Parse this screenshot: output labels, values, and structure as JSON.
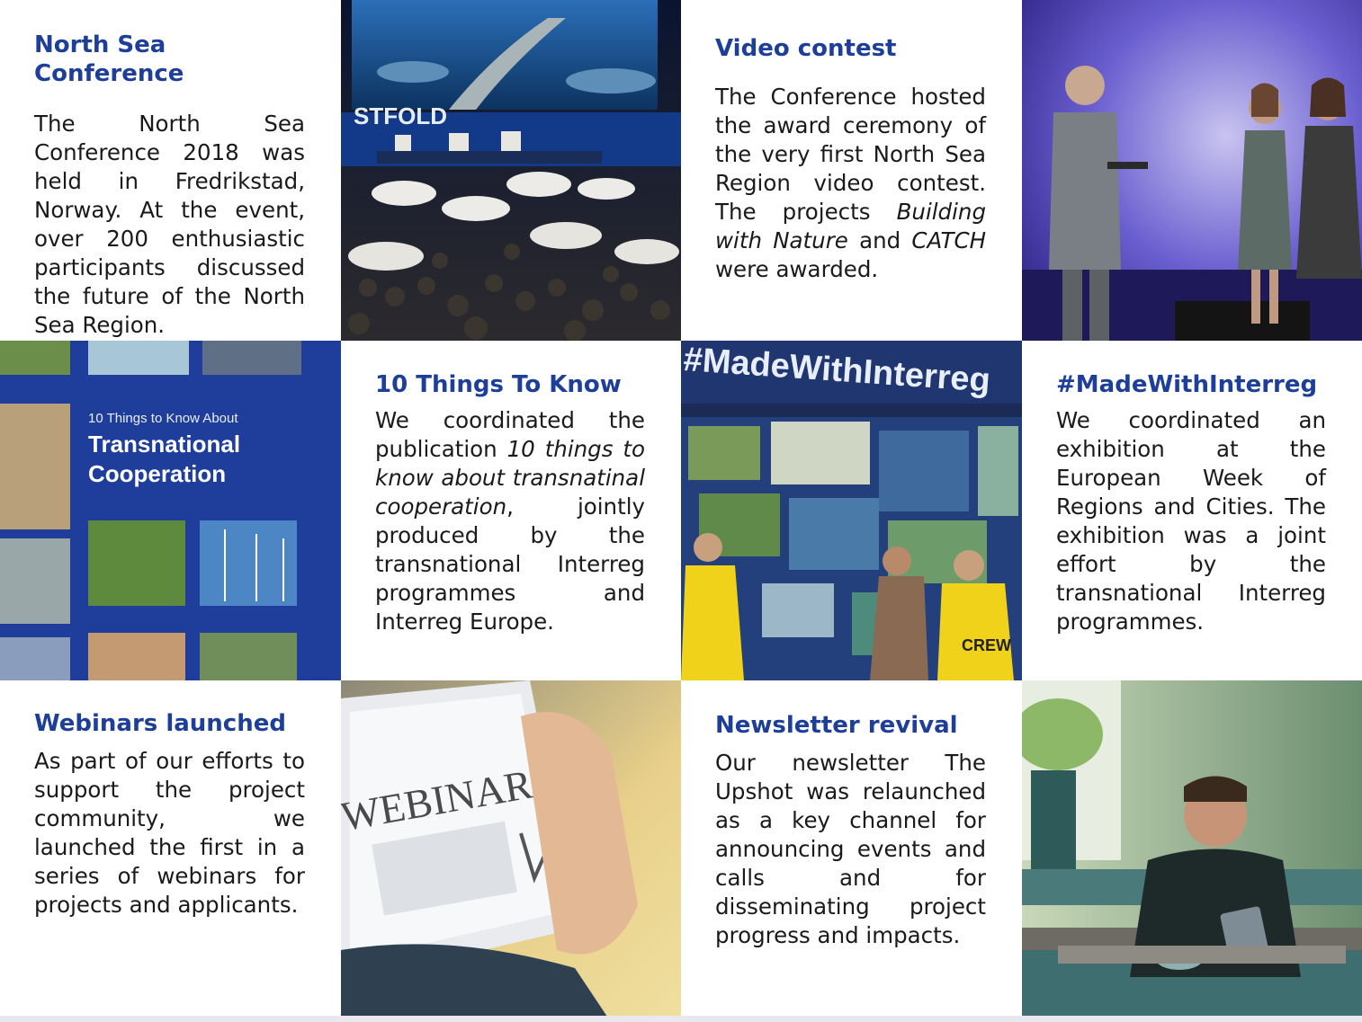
{
  "tiles": {
    "north_sea": {
      "title": "North Sea Conference",
      "body": "The North Sea Conference 2018 was held in Fredrikstad, Norway. At the event, over 200 enthusiastic participants discussed the future of the North Sea Region."
    },
    "video": {
      "title": "Video contest",
      "body_1": "The Conference hosted the award ceremony of the very first North Sea Region video contest. The projects ",
      "project_1": "Building with Nature",
      "body_2": " and ",
      "project_2": "CATCH",
      "body_3": " were awarded."
    },
    "ten_things": {
      "title": "10 Things To Know",
      "body_1": "We coordinated the publication ",
      "publication": "10 things to know about transnatinal cooperation",
      "body_2": ", jointly produced by the transnational Interreg programmes and Interreg Europe."
    },
    "made_with": {
      "title": "#MadeWithInterreg",
      "body": "We coordinated an exhibition at the European Week of Regions and Cities. The exhibition was a joint effort by the transnational Interreg programmes."
    },
    "webinars": {
      "title": "Webinars launched",
      "body": "As part of our efforts to support the project community, we launched the first in a series of webinars for projects and applicants."
    },
    "newsletter": {
      "title": "Newsletter revival",
      "body": "Our newsletter The Upshot was relaunched as a key channel for announcing events and calls and for disseminating project progress and impacts."
    }
  },
  "photos": {
    "conference_stage_sign": "STFOLD",
    "booklet_subtitle": "10 Things to Know About",
    "booklet_title_1": "Transnational",
    "booklet_title_2": "Cooperation",
    "exhibition_banner": "#MadeWithInterreg",
    "exhibition_shirt": "CREW",
    "tablet_screen": "WEBINAR"
  },
  "colors": {
    "heading_blue": "#1d3f9a",
    "booklet_blue": "#1f3e9b"
  }
}
